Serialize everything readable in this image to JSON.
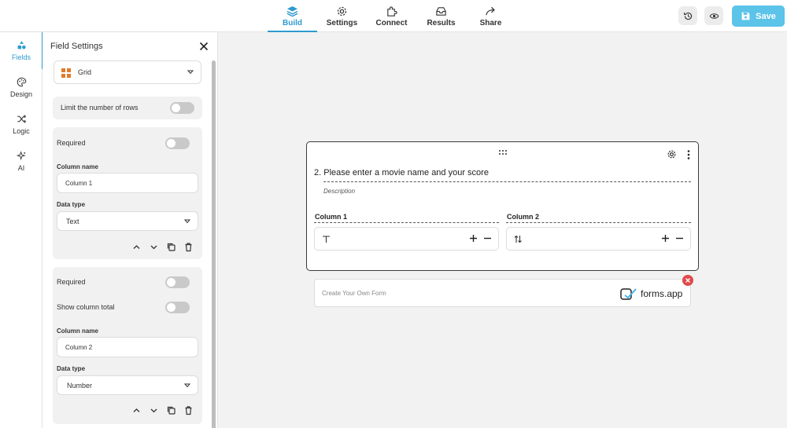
{
  "nav": {
    "items": [
      {
        "label": "Build",
        "icon": "stack-icon",
        "active": true
      },
      {
        "label": "Settings",
        "icon": "gear-icon",
        "active": false
      },
      {
        "label": "Connect",
        "icon": "puzzle-icon",
        "active": false
      },
      {
        "label": "Results",
        "icon": "inbox-icon",
        "active": false
      },
      {
        "label": "Share",
        "icon": "share-arrow-icon",
        "active": false
      }
    ]
  },
  "toolbar": {
    "save_label": "Save"
  },
  "rail": {
    "items": [
      {
        "label": "Fields",
        "icon": "shapes-icon",
        "active": true
      },
      {
        "label": "Design",
        "icon": "palette-icon",
        "active": false
      },
      {
        "label": "Logic",
        "icon": "shuffle-icon",
        "active": false
      },
      {
        "label": "AI",
        "icon": "sparkle-icon",
        "active": false
      }
    ]
  },
  "panel": {
    "title": "Field Settings",
    "field_type": "Grid",
    "limit_rows_label": "Limit the number of rows",
    "column1": {
      "required_label": "Required",
      "name_label": "Column name",
      "name_value": "Column 1",
      "type_label": "Data type",
      "type_value": "Text"
    },
    "column2": {
      "required_label": "Required",
      "total_label": "Show column total",
      "name_label": "Column name",
      "name_value": "Column 2",
      "type_label": "Data type",
      "type_value": "Number"
    }
  },
  "question": {
    "title": "2. Please enter a movie name and your score",
    "description": "Description",
    "columns": [
      {
        "label": "Column 1",
        "type_icon": "text-type-icon"
      },
      {
        "label": "Column 2",
        "type_icon": "sort-number-icon"
      }
    ]
  },
  "promo": {
    "text": "Create Your Own Form",
    "brand": "forms.app"
  },
  "colors": {
    "accent": "#2e9ad0",
    "save_button": "#5cc3e9",
    "close_badge": "#e04a4a"
  }
}
